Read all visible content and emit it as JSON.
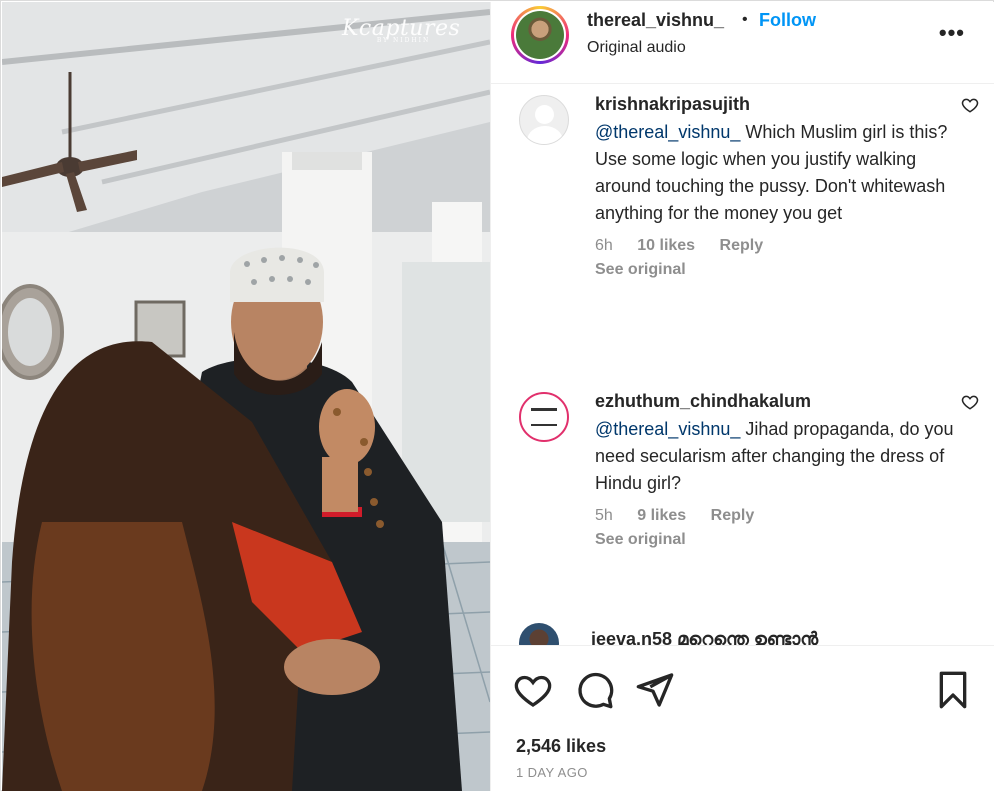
{
  "media": {
    "watermark": "Kcaptures",
    "watermark_sub": "BY NIDHIN"
  },
  "post": {
    "username": "thereal_vishnu_",
    "separator": "•",
    "follow_label": "Follow",
    "audio": "Original audio",
    "more_label": "•••"
  },
  "comments": [
    {
      "username": "krishnakripasujith",
      "mention": "@thereal_vishnu_",
      "text": " Which Muslim girl is this? Use some logic when you justify walking around touching the pussy. Don't whitewash anything for the money you get",
      "time": "6h",
      "likes": "10 likes",
      "reply": "Reply",
      "see_original": "See original",
      "avatar": "default-avatar-icon"
    },
    {
      "username": "ezhuthum_chindhakalum",
      "mention": "@thereal_vishnu_",
      "text": " Jihad propaganda, do you need secularism after changing the dress of Hindu girl?",
      "time": "5h",
      "likes": "9 likes",
      "reply": "Reply",
      "see_original": "See original",
      "avatar": "logo-avatar"
    }
  ],
  "partial_comment": {
    "username": "jeeva.n58 മറ്റെന്തെ ഉണ്ടാൻ"
  },
  "actions": {
    "likes": "2,546 likes",
    "posted": "1 DAY AGO",
    "icons": [
      "heart-icon",
      "comment-icon",
      "share-icon",
      "bookmark-icon"
    ]
  },
  "colors": {
    "accent": "#0095f6",
    "mention": "#00376b",
    "muted": "#8e8e8e"
  }
}
